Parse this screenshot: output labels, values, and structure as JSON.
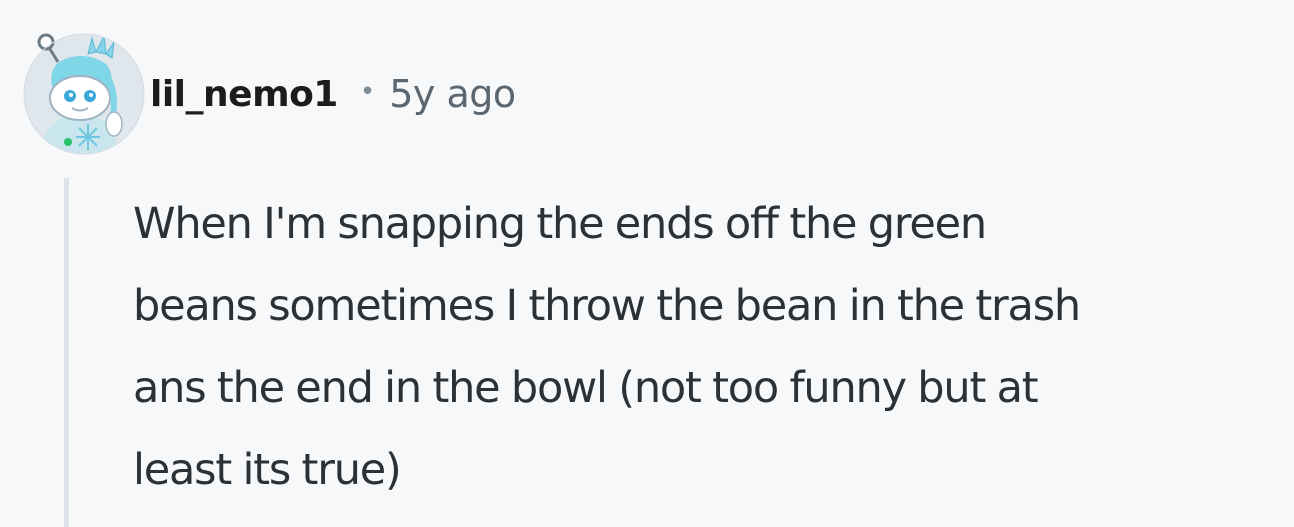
{
  "comment": {
    "author": "lil_nemo1",
    "separator": "•",
    "timestamp": "5y ago",
    "avatar_icon": "snoo-avatar-ice-crown-icon",
    "body_lines": [
      "When I'm snapping the ends off the green",
      "beans sometimes I throw the bean in the trash",
      "ans the end in the bowl (not too funny but at",
      "least its true)"
    ]
  },
  "colors": {
    "background": "#f7f8fa",
    "username": "#1c1c1c",
    "timestamp": "#5b6770",
    "body": "#2a3238",
    "thread_line": "#dde3ea"
  }
}
